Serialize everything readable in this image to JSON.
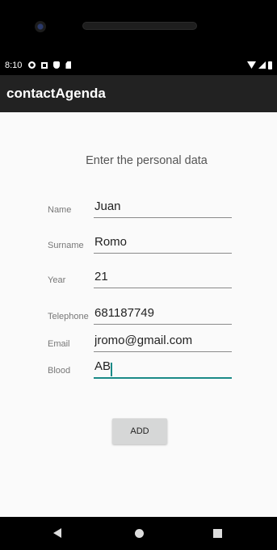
{
  "status_bar": {
    "time": "8:10"
  },
  "app_bar": {
    "title": "contactAgenda"
  },
  "form": {
    "heading": "Enter the personal data",
    "fields": [
      {
        "label": "Name",
        "value": "Juan"
      },
      {
        "label": "Surname",
        "value": "Romo"
      },
      {
        "label": "Year",
        "value": "21"
      },
      {
        "label": "Telephone",
        "value": "681187749"
      },
      {
        "label": "Email",
        "value": "jromo@gmail.com"
      },
      {
        "label": "Blood",
        "value": "AB"
      }
    ],
    "add_label": "ADD"
  },
  "colors": {
    "accent": "#1a8a87",
    "app_bar": "#222222"
  }
}
